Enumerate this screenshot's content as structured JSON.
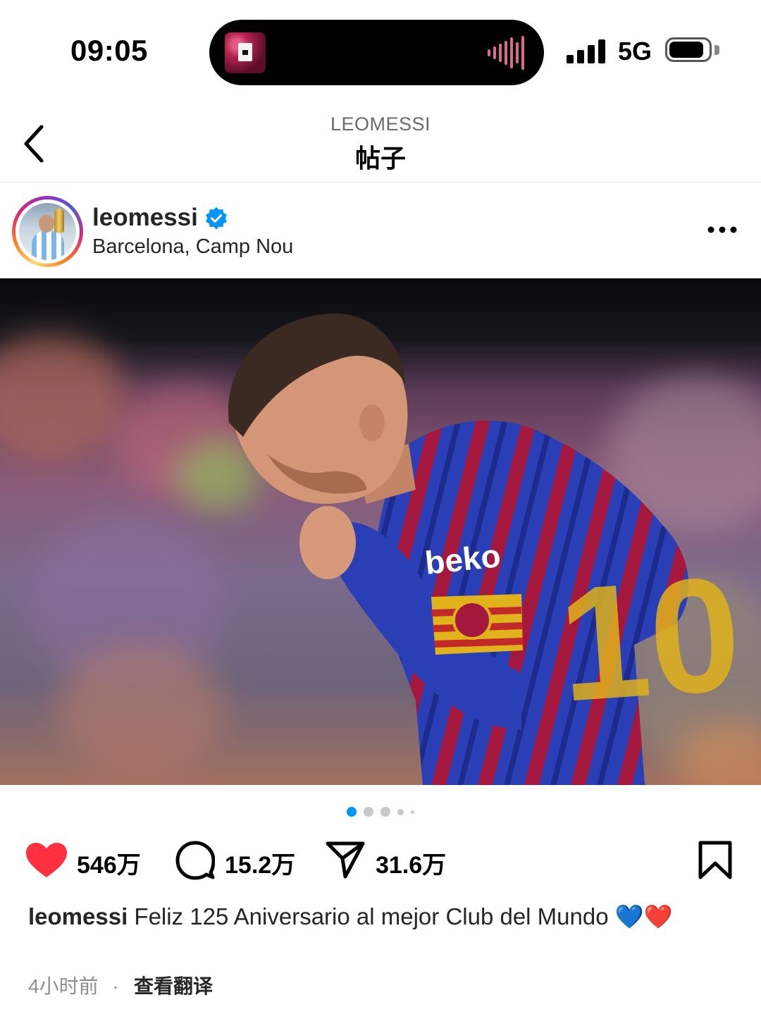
{
  "status_bar": {
    "time": "09:05",
    "network": "5G",
    "signal_icon": "cellular-signal-icon",
    "battery_icon": "battery-icon",
    "battery_level": 0.85
  },
  "nav": {
    "back_icon": "chevron-left-icon",
    "subtitle": "LEOMESSI",
    "title": "帖子"
  },
  "post": {
    "username": "leomessi",
    "verified_icon": "verified-badge-icon",
    "location": "Barcelona, Camp Nou",
    "more_icon": "more-horizontal-icon",
    "carousel": {
      "count": 5,
      "active_index": 0,
      "active_color": "#0095f6"
    },
    "actions": {
      "likes": "546万",
      "comments": "15.2万",
      "shares": "31.6万",
      "like_icon": "heart-filled-icon",
      "like_color": "#ff3040",
      "comment_icon": "comment-icon",
      "share_icon": "send-icon",
      "save_icon": "bookmark-icon"
    },
    "caption": {
      "username": "leomessi",
      "text": "Feliz 125 Aniversario al mejor Club del Mundo 💙❤️"
    },
    "time_ago": "4小时前",
    "separator": "·",
    "translate_label": "查看翻译"
  }
}
